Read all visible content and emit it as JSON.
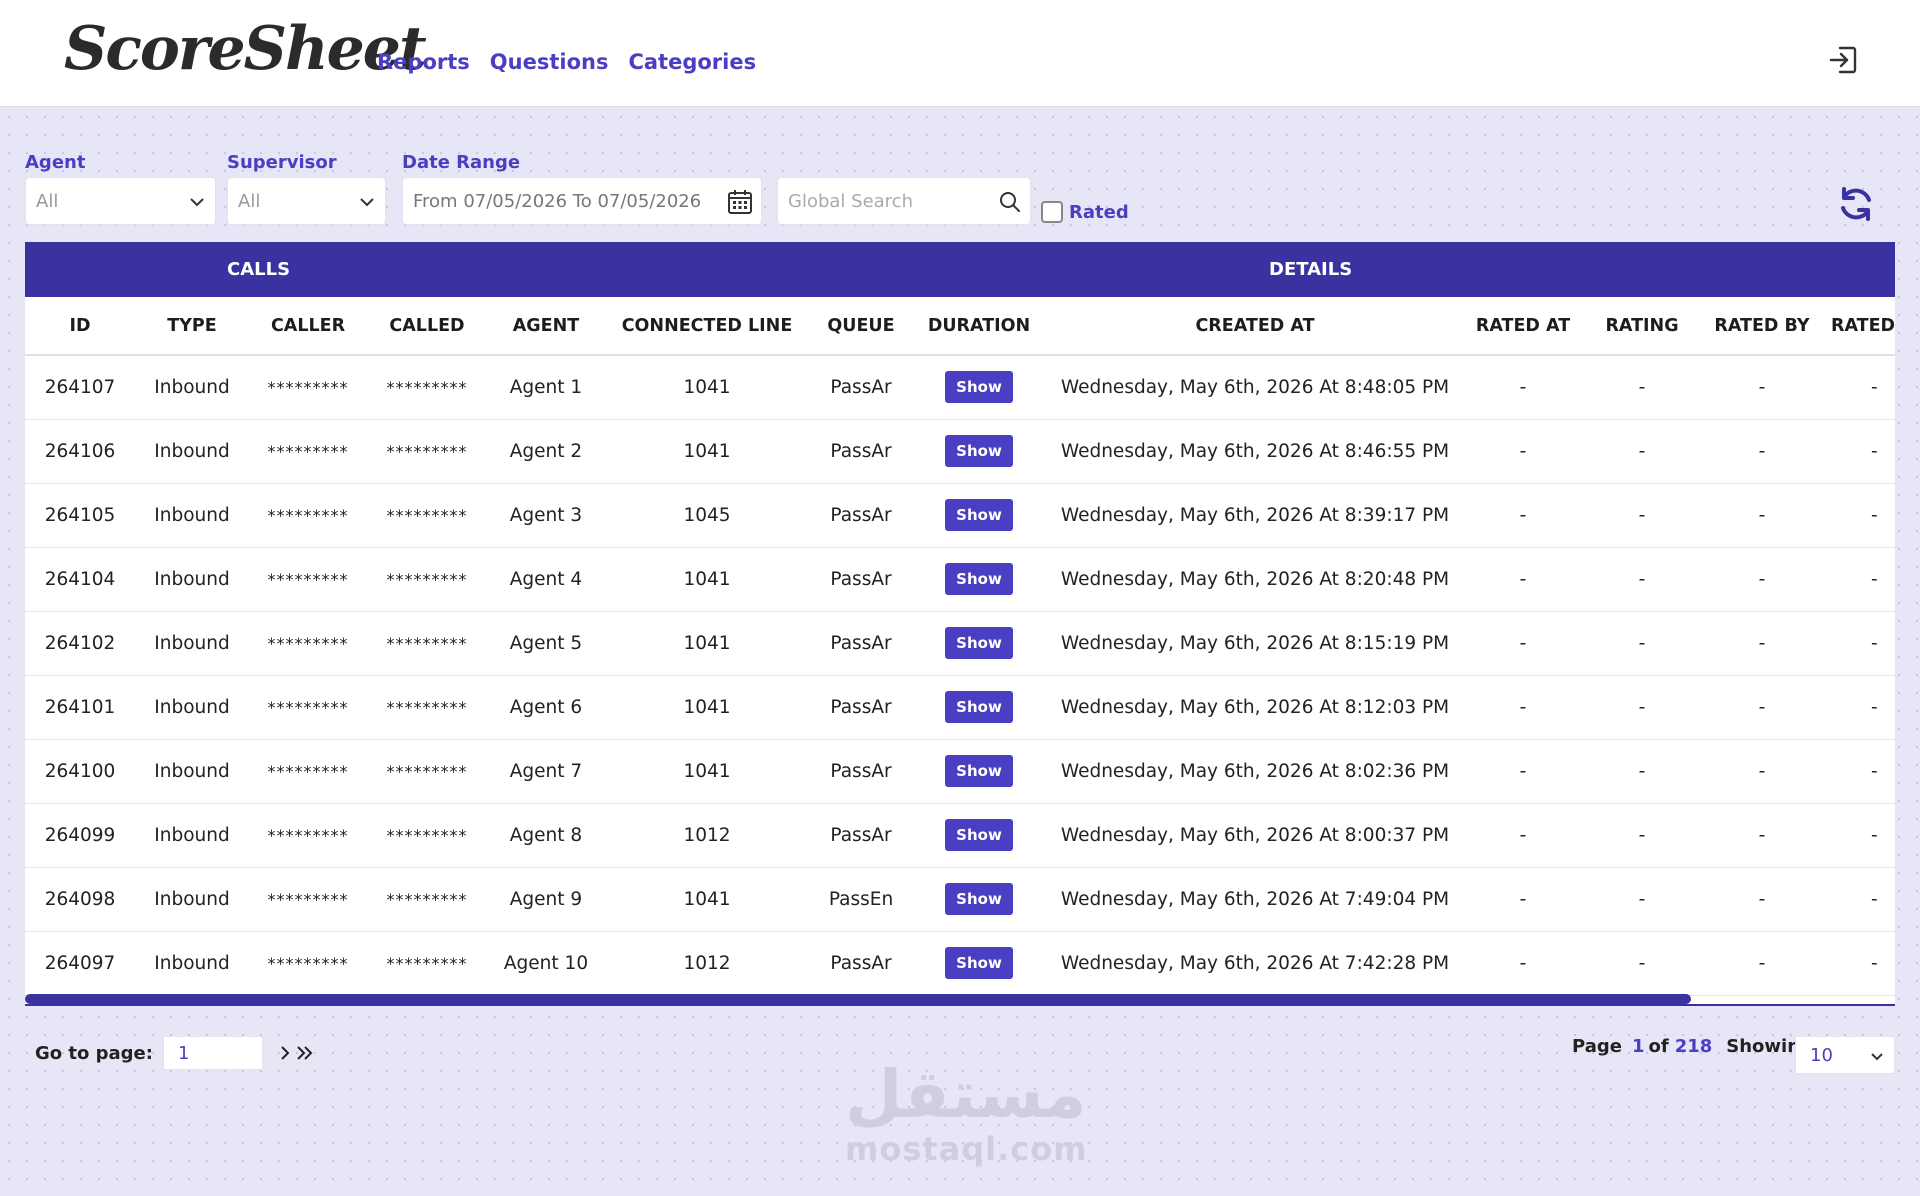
{
  "app": {
    "logo": "ScoreSheet"
  },
  "nav": {
    "reports": "Reports",
    "questions": "Questions",
    "categories": "Categories"
  },
  "filters": {
    "agent_label": "Agent",
    "agent_value": "All",
    "supervisor_label": "Supervisor",
    "supervisor_value": "All",
    "date_label": "Date Range",
    "date_value": "From 07/05/2026 To 07/05/2026",
    "search_placeholder": "Global Search",
    "rated_label": "Rated",
    "rated_checked": false
  },
  "table": {
    "group_calls": "CALLS",
    "group_details": "DETAILS",
    "columns": [
      "ID",
      "TYPE",
      "CALLER",
      "CALLED",
      "AGENT",
      "CONNECTED LINE",
      "QUEUE",
      "DURATION",
      "CREATED AT",
      "RATED AT",
      "RATING",
      "RATED BY",
      "RATED"
    ],
    "show_label": "Show",
    "rows": [
      {
        "id": "264107",
        "type": "Inbound",
        "caller": "*********",
        "called": "*********",
        "agent": "Agent 1",
        "line": "1041",
        "queue": "PassAr",
        "created": "Wednesday, May 6th, 2026 At 8:48:05 PM",
        "rated_at": "-",
        "rating": "-",
        "rated_by": "-",
        "rated": "-"
      },
      {
        "id": "264106",
        "type": "Inbound",
        "caller": "*********",
        "called": "*********",
        "agent": "Agent 2",
        "line": "1041",
        "queue": "PassAr",
        "created": "Wednesday, May 6th, 2026 At 8:46:55 PM",
        "rated_at": "-",
        "rating": "-",
        "rated_by": "-",
        "rated": "-"
      },
      {
        "id": "264105",
        "type": "Inbound",
        "caller": "*********",
        "called": "*********",
        "agent": "Agent 3",
        "line": "1045",
        "queue": "PassAr",
        "created": "Wednesday, May 6th, 2026 At 8:39:17 PM",
        "rated_at": "-",
        "rating": "-",
        "rated_by": "-",
        "rated": "-"
      },
      {
        "id": "264104",
        "type": "Inbound",
        "caller": "*********",
        "called": "*********",
        "agent": "Agent 4",
        "line": "1041",
        "queue": "PassAr",
        "created": "Wednesday, May 6th, 2026 At 8:20:48 PM",
        "rated_at": "-",
        "rating": "-",
        "rated_by": "-",
        "rated": "-"
      },
      {
        "id": "264102",
        "type": "Inbound",
        "caller": "*********",
        "called": "*********",
        "agent": "Agent 5",
        "line": "1041",
        "queue": "PassAr",
        "created": "Wednesday, May 6th, 2026 At 8:15:19 PM",
        "rated_at": "-",
        "rating": "-",
        "rated_by": "-",
        "rated": "-"
      },
      {
        "id": "264101",
        "type": "Inbound",
        "caller": "*********",
        "called": "*********",
        "agent": "Agent 6",
        "line": "1041",
        "queue": "PassAr",
        "created": "Wednesday, May 6th, 2026 At 8:12:03 PM",
        "rated_at": "-",
        "rating": "-",
        "rated_by": "-",
        "rated": "-"
      },
      {
        "id": "264100",
        "type": "Inbound",
        "caller": "*********",
        "called": "*********",
        "agent": "Agent 7",
        "line": "1041",
        "queue": "PassAr",
        "created": "Wednesday, May 6th, 2026 At 8:02:36 PM",
        "rated_at": "-",
        "rating": "-",
        "rated_by": "-",
        "rated": "-"
      },
      {
        "id": "264099",
        "type": "Inbound",
        "caller": "*********",
        "called": "*********",
        "agent": "Agent 8",
        "line": "1012",
        "queue": "PassAr",
        "created": "Wednesday, May 6th, 2026 At 8:00:37 PM",
        "rated_at": "-",
        "rating": "-",
        "rated_by": "-",
        "rated": "-"
      },
      {
        "id": "264098",
        "type": "Inbound",
        "caller": "*********",
        "called": "*********",
        "agent": "Agent 9",
        "line": "1041",
        "queue": "PassEn",
        "created": "Wednesday, May 6th, 2026 At 7:49:04 PM",
        "rated_at": "-",
        "rating": "-",
        "rated_by": "-",
        "rated": "-"
      },
      {
        "id": "264097",
        "type": "Inbound",
        "caller": "*********",
        "called": "*********",
        "agent": "Agent 10",
        "line": "1012",
        "queue": "PassAr",
        "created": "Wednesday, May 6th, 2026 At 7:42:28 PM",
        "rated_at": "-",
        "rating": "-",
        "rated_by": "-",
        "rated": "-"
      }
    ]
  },
  "pagination": {
    "goto_label": "Go to page:",
    "goto_value": "1",
    "page_label": "Page",
    "current": "1",
    "of_label": "of",
    "total": "218",
    "showing_label": "Showing",
    "page_size": "10"
  },
  "watermark": {
    "arabic": "مستقل",
    "latin": "mostaql.com"
  },
  "colors": {
    "accent": "#4a3ec2",
    "header_bg": "#3a32a0",
    "page_bg": "#e7e6f6"
  }
}
